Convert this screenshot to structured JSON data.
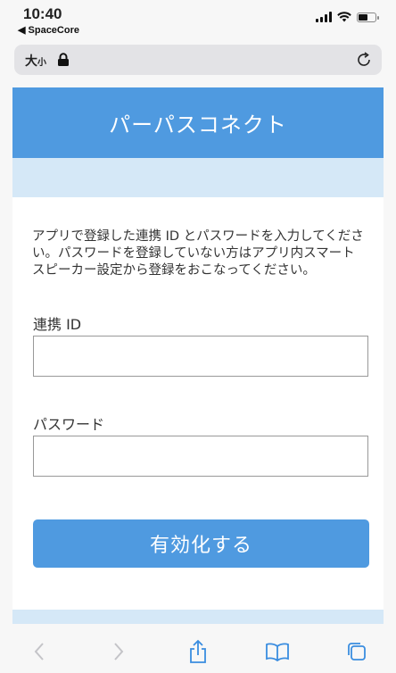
{
  "status_bar": {
    "time": "10:40",
    "back_app": "◀ SpaceCore"
  },
  "browser": {
    "text_size_label": "大",
    "text_size_small": "小",
    "address_icon": "lock-icon",
    "reload_icon": "reload-icon",
    "accent": "#4f9ae0"
  },
  "page": {
    "title": "パーパスコネクト",
    "description": "アプリで登録した連携 ID とパスワードを入力してください。パスワードを登録していない方はアプリ内スマートスピーカー設定から登録をおこなってください。",
    "id_label": "連携 ID",
    "id_value": "",
    "password_label": "パスワード",
    "password_value": "",
    "submit_label": "有効化する"
  },
  "toolbar": {
    "items": [
      "back-icon",
      "forward-icon",
      "share-icon",
      "bookmarks-icon",
      "tabs-icon"
    ]
  }
}
